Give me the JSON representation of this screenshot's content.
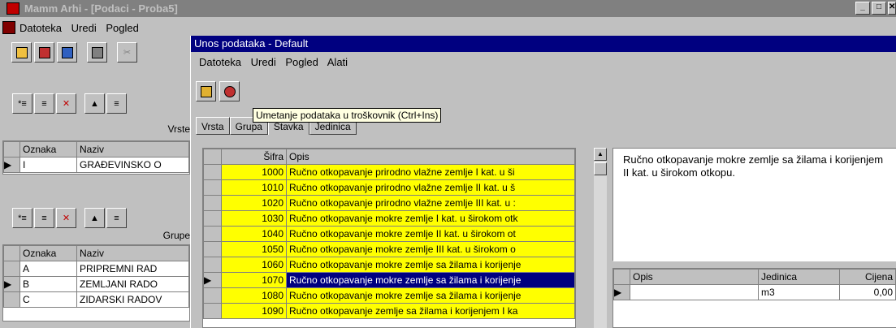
{
  "main_window": {
    "title": "Mamm Arhi - [Podaci - Proba5]",
    "menu": [
      "Datoteka",
      "Uredi",
      "Pogled"
    ],
    "vrste_label": "Vrste",
    "grupe_label": "Grupe",
    "vrste_grid": {
      "headers": [
        "Oznaka",
        "Naziv"
      ],
      "rows": [
        [
          "I",
          "GRAĐEVINSKO O"
        ]
      ]
    },
    "grupe_grid": {
      "headers": [
        "Oznaka",
        "Naziv"
      ],
      "rows": [
        [
          "A",
          "PRIPREMNI RAD"
        ],
        [
          "B",
          "ZEMLJANI RADO"
        ],
        [
          "C",
          "ZIDARSKI RADOV"
        ]
      ]
    }
  },
  "dialog": {
    "title": "Unos podataka - Default",
    "menu": [
      "Datoteka",
      "Uredi",
      "Pogled",
      "Alati"
    ],
    "tooltip": "Umetanje podataka u troškovnik (Ctrl+Ins)",
    "tabs": [
      "Vrsta",
      "Grupa",
      "Stavka",
      "Jedinica"
    ],
    "active_tab": "Stavka",
    "items_grid": {
      "headers": [
        "Šifra",
        "Opis"
      ],
      "rows": [
        [
          "1000",
          "Ručno otkopavanje prirodno vlažne zemlje I kat. u ši"
        ],
        [
          "1010",
          "Ručno otkopavanje prirodno vlažne zemlje II kat. u š"
        ],
        [
          "1020",
          "Ručno otkopavanje prirodno vlažne zemlje III kat. u :"
        ],
        [
          "1030",
          "Ručno otkopavanje mokre zemlje I kat. u širokom otk"
        ],
        [
          "1040",
          "Ručno otkopavanje mokre zemlje II kat. u širokom ot"
        ],
        [
          "1050",
          "Ručno otkopavanje mokre zemlje III kat. u širokom o"
        ],
        [
          "1060",
          "Ručno otkopavanje mokre zemlje sa žilama i korijenje"
        ],
        [
          "1070",
          "Ručno otkopavanje mokre zemlje sa žilama i korijenje"
        ],
        [
          "1080",
          "Ručno otkopavanje mokre zemlje sa žilama i korijenje"
        ],
        [
          "1090",
          "Ručno otkopavanje zemlje sa žilama i korijenjem I ka"
        ]
      ],
      "selected_index": 7
    },
    "description": "Ručno otkopavanje mokre zemlje sa žilama i korijenjem II kat. u širokom otkopu.",
    "units_grid": {
      "headers": [
        "Opis",
        "Jedinica",
        "Cijena"
      ],
      "rows": [
        [
          "",
          "m3",
          "0,00"
        ]
      ]
    }
  }
}
